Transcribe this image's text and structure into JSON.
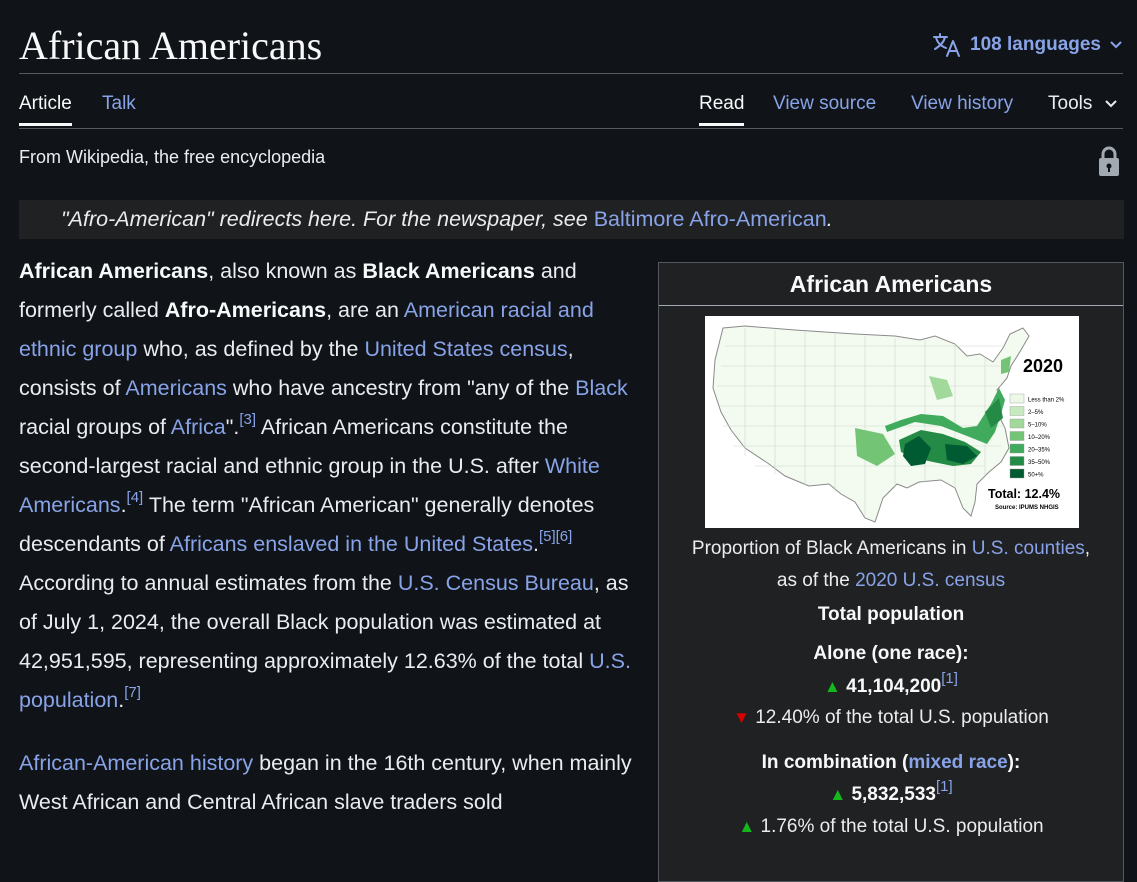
{
  "page": {
    "title": "African Americans",
    "languages_label": "108 languages",
    "tagline": "From Wikipedia, the free encyclopedia"
  },
  "tabs": {
    "article": "Article",
    "talk": "Talk",
    "read": "Read",
    "view_source": "View source",
    "view_history": "View history",
    "tools": "Tools"
  },
  "hatnote": {
    "text": "\"Afro-American\" redirects here. For the newspaper, see ",
    "link": "Baltimore Afro-American",
    "end": "."
  },
  "para1": {
    "s1": "African Americans",
    "s2": ", also known as ",
    "s3": "Black Americans",
    "s4": " and formerly called ",
    "s5": "Afro-Americans",
    "s6": ", are an ",
    "l1": "American racial and ethnic group",
    "s7": " who, as defined by the ",
    "l2": "United States census",
    "s8": ", consists of ",
    "l3": "Americans",
    "s9": " who have ancestry from \"any of the ",
    "l4": "Black",
    "s10": " racial groups of ",
    "l5": "Africa",
    "s11": "\".",
    "r1": "[3]",
    "s12": " African Americans constitute the second-largest racial and ethnic group in the U.S. after ",
    "l6": "White Americans",
    "s13": ".",
    "r2": "[4]",
    "s14": " The term \"African American\" generally denotes descendants of ",
    "l7": "Africans enslaved in the United States",
    "s15": ".",
    "r3": "[5]",
    "r4": "[6]",
    "s16": " According to annual estimates from the ",
    "l8": "U.S. Census Bureau",
    "s17": ", as of July 1, 2024, the overall Black population was estimated at 42,951,595, representing approximately 12.63% of the total ",
    "l9": "U.S. population",
    "s18": ".",
    "r5": "[7]"
  },
  "para2": {
    "l1": "African-American history",
    "s1": " began in the 16th century, when mainly West African and Central African slave traders sold"
  },
  "infobox": {
    "title": "African Americans",
    "map": {
      "year": "2020",
      "legend": [
        "Less than 2%",
        "2–5%",
        "5–10%",
        "10–20%",
        "20–35%",
        "35–50%",
        "50+%"
      ],
      "legend_colors": [
        "#edf8e9",
        "#c7e9c0",
        "#a1d99b",
        "#74c476",
        "#41ab5d",
        "#238b45",
        "#005a32"
      ],
      "total": "Total: 12.4%",
      "source": "Source: IPUMS NHGIS"
    },
    "caption_1": "Proportion of Black Americans in ",
    "caption_link1": "U.S. counties",
    "caption_2": ",",
    "caption_3": "as of the ",
    "caption_link2": "2020 U.S. census",
    "total_population": "Total population",
    "alone_label": "Alone (one race):",
    "alone_value": "41,104,200",
    "alone_ref": "[1]",
    "alone_pct": "12.40% of the total U.S. population",
    "combo_label_1": "In combination (",
    "combo_link": "mixed race",
    "combo_label_2": "):",
    "combo_value": "5,832,533",
    "combo_ref": "[1]",
    "combo_pct": "1.76% of the total U.S. population"
  }
}
